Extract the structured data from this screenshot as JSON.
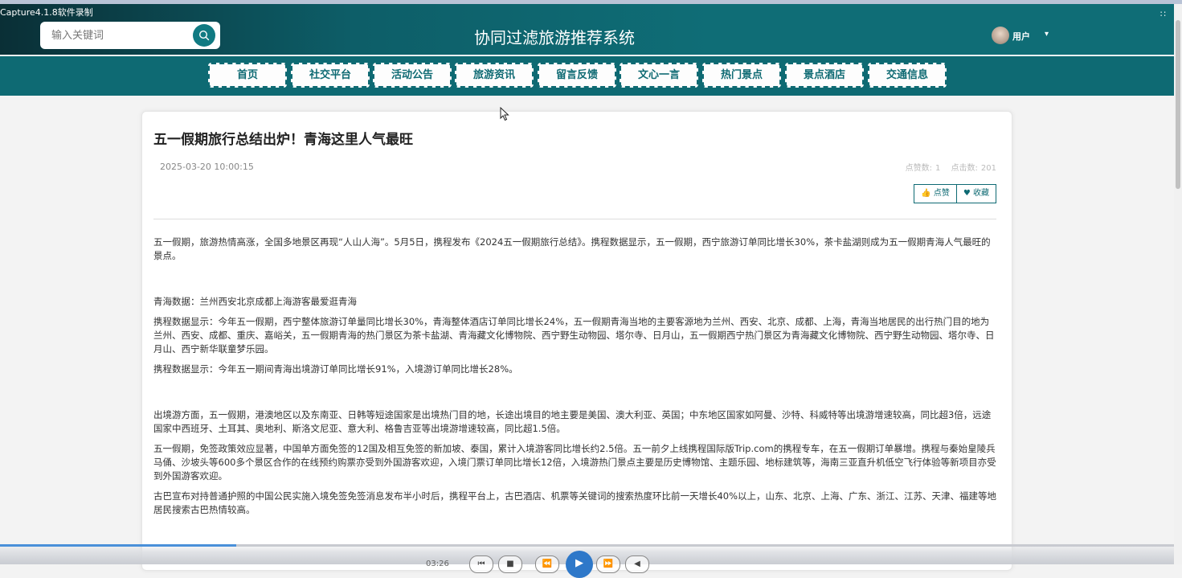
{
  "overlay": {
    "capture_label": "Capture4.1.8软件录制",
    "corner_icon": "∷"
  },
  "header": {
    "search_placeholder": "输入关键词",
    "site_title": "协同过滤旅游推荐系统",
    "user_name": "用户",
    "user_caret": "▾"
  },
  "nav": {
    "items": [
      {
        "label": "首页"
      },
      {
        "label": "社交平台"
      },
      {
        "label": "活动公告"
      },
      {
        "label": "旅游资讯"
      },
      {
        "label": "留言反馈"
      },
      {
        "label": "文心一言"
      },
      {
        "label": "热门景点"
      },
      {
        "label": "景点酒店"
      },
      {
        "label": "交通信息"
      }
    ]
  },
  "article": {
    "title": "五一假期旅行总结出炉！青海这里人气最旺",
    "date": "2025-03-20 10:00:15",
    "likes_label": "点赞数:",
    "likes_value": "1",
    "clicks_label": "点击数:",
    "clicks_value": "201",
    "like_button": "👍 点赞",
    "fav_button": "♥ 收藏",
    "paragraphs": [
      "五一假期，旅游热情高涨，全国多地景区再现“人山人海”。5月5日，携程发布《2024五一假期旅行总结》。携程数据显示，五一假期，西宁旅游订单同比增长30%，茶卡盐湖则成为五一假期青海人气最旺的景点。",
      "",
      "青海数据：兰州西安北京成都上海游客最爱逛青海",
      "携程数据显示：今年五一假期，西宁整体旅游订单量同比增长30%，青海整体酒店订单同比增长24%，五一假期青海当地的主要客源地为兰州、西安、北京、成都、上海，青海当地居民的出行热门目的地为兰州、西安、成都、重庆、嘉峪关，五一假期青海的热门景区为茶卡盐湖、青海藏文化博物院、西宁野生动物园、塔尔寺、日月山，五一假期西宁热门景区为青海藏文化博物院、西宁野生动物园、塔尔寺、日月山、西宁新华联童梦乐园。",
      "携程数据显示：今年五一期间青海出境游订单同比增长91%，入境游订单同比增长28%。",
      "",
      "出境游方面，五一假期，港澳地区以及东南亚、日韩等短途国家是出境热门目的地，长途出境目的地主要是美国、澳大利亚、英国；中东地区国家如阿曼、沙特、科威特等出境游增速较高，同比超3倍，远途国家中西班牙、土耳其、奥地利、斯洛文尼亚、意大利、格鲁吉亚等出境游增速较高，同比超1.5倍。",
      "五一假期，免签政策效应显著，中国单方面免签的12国及相互免签的新加坡、泰国，累计入境游客同比增长约2.5倍。五一前夕上线携程国际版Trip.com的携程专车，在五一假期订单暴增。携程与秦始皇陵兵马俑、沙坡头等600多个景区合作的在线预约购票亦受到外国游客欢迎，入境门票订单同比增长12倍，入境游热门景点主要是历史博物馆、主题乐园、地标建筑等，海南三亚直升机低空飞行体验等新项目亦受到外国游客欢迎。",
      "古巴宣布对持普通护照的中国公民实施入境免签免签消息发布半小时后，携程平台上，古巴酒店、机票等关键词的搜索热度环比前一天增长40%以上，山东、北京、上海、广东、浙江、江苏、天津、福建等地居民搜索古巴热情较高。"
    ]
  },
  "player": {
    "time": "03:26",
    "progress_fraction": 0.2,
    "controls": [
      "⏮",
      "■",
      "⏪",
      "⏩",
      "◀"
    ],
    "play_symbol": "▶"
  },
  "colors": {
    "primary": "#0e6a73",
    "header_dark": "#0a2f36",
    "accent_blue": "#2e78c9"
  }
}
